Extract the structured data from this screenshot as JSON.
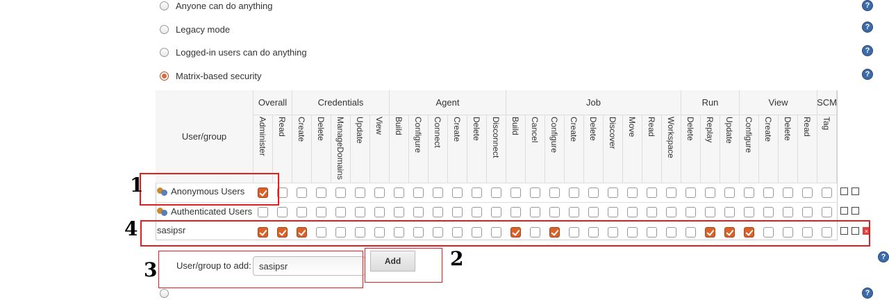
{
  "security_options": [
    {
      "label": "Anyone can do anything",
      "selected": false
    },
    {
      "label": "Legacy mode",
      "selected": false
    },
    {
      "label": "Logged-in users can do anything",
      "selected": false
    },
    {
      "label": "Matrix-based security",
      "selected": true
    }
  ],
  "help_icon": "?",
  "matrix": {
    "user_group_header": "User/group",
    "groups": [
      {
        "name": "Overall",
        "perms": [
          "Administer",
          "Read"
        ]
      },
      {
        "name": "Credentials",
        "perms": [
          "Create",
          "Delete",
          "ManageDomains",
          "Update",
          "View"
        ]
      },
      {
        "name": "Agent",
        "perms": [
          "Build",
          "Configure",
          "Connect",
          "Create",
          "Delete",
          "Disconnect"
        ]
      },
      {
        "name": "Job",
        "perms": [
          "Build",
          "Cancel",
          "Configure",
          "Create",
          "Delete",
          "Discover",
          "Move",
          "Read",
          "Workspace"
        ]
      },
      {
        "name": "Run",
        "perms": [
          "Delete",
          "Replay",
          "Update"
        ]
      },
      {
        "name": "View",
        "perms": [
          "Configure",
          "Create",
          "Delete",
          "Read"
        ]
      },
      {
        "name": "SCM",
        "perms": [
          "Tag"
        ]
      }
    ],
    "rows": [
      {
        "name": "Anonymous Users",
        "icon": "users-icon",
        "checked": [
          0
        ]
      },
      {
        "name": "Authenticated Users",
        "icon": "users-icon",
        "checked": []
      },
      {
        "name": "sasipsr",
        "icon": "",
        "checked": [
          0,
          1,
          2,
          13,
          15,
          23,
          24,
          25
        ]
      }
    ]
  },
  "add_user": {
    "label": "User/group to add:",
    "value": "sasipsr",
    "button": "Add"
  },
  "annotations": [
    "1",
    "2",
    "3",
    "4"
  ],
  "colors": {
    "checked": "#d9622b",
    "annotation_box": "#e02020",
    "help": "#3d6aa8"
  }
}
